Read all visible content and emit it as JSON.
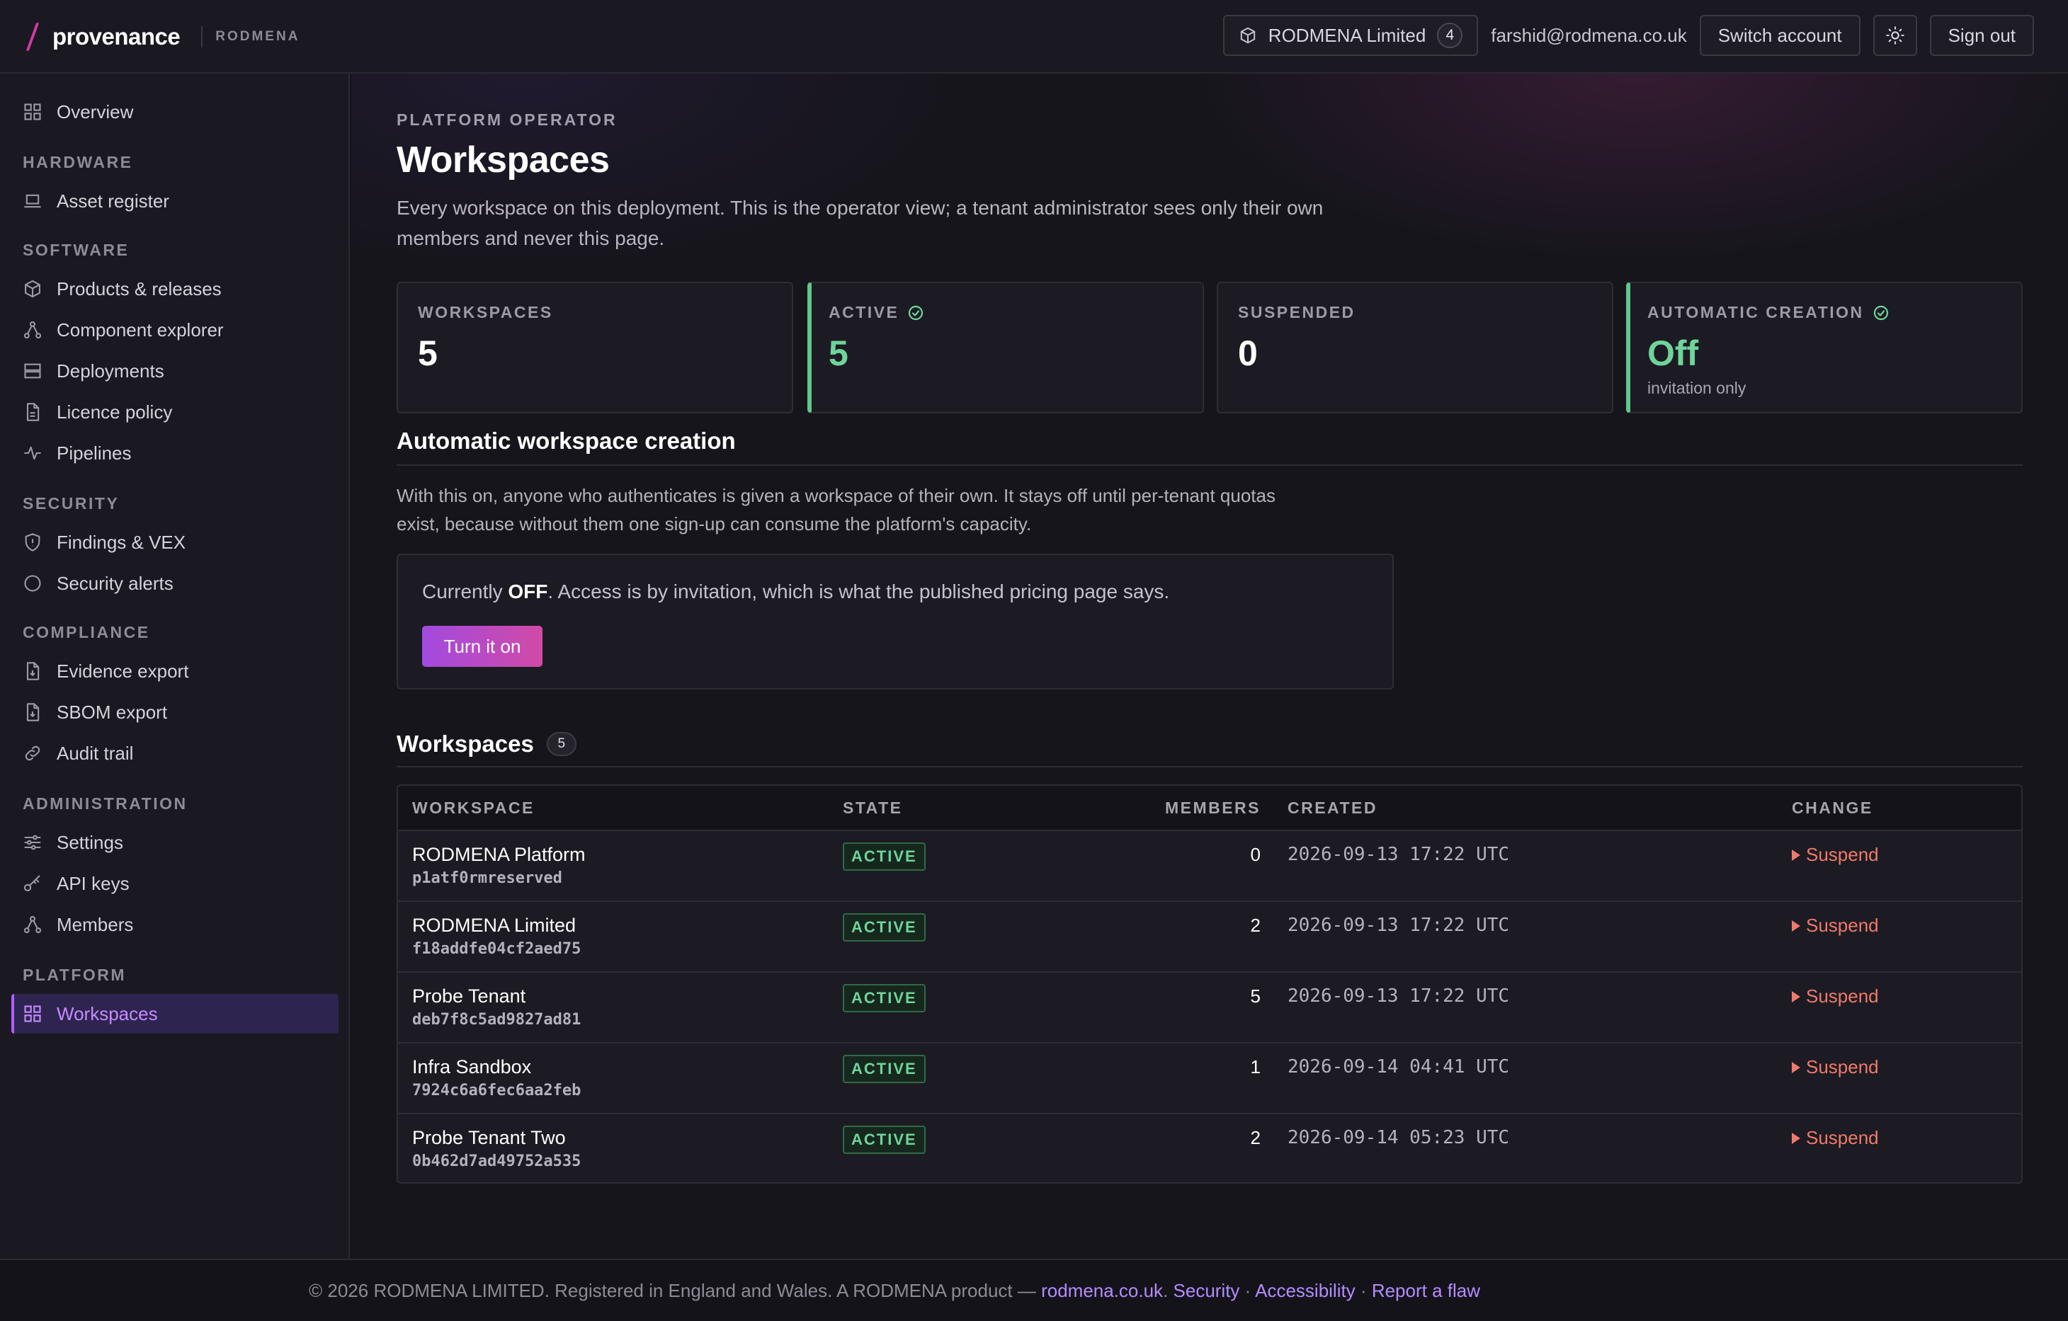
{
  "brand": {
    "name": "provenance",
    "org": "RODMENA"
  },
  "topbar": {
    "tenant_name": "RODMENA Limited",
    "tenant_count": "4",
    "email": "farshid@rodmena.co.uk",
    "switch_label": "Switch account",
    "signout_label": "Sign out"
  },
  "sidebar": {
    "overview": "Overview",
    "hardware_head": "HARDWARE",
    "asset_register": "Asset register",
    "software_head": "SOFTWARE",
    "products": "Products & releases",
    "component_explorer": "Component explorer",
    "deployments": "Deployments",
    "licence_policy": "Licence policy",
    "pipelines": "Pipelines",
    "security_head": "SECURITY",
    "findings": "Findings & VEX",
    "security_alerts": "Security alerts",
    "compliance_head": "COMPLIANCE",
    "evidence_export": "Evidence export",
    "sbom_export": "SBOM export",
    "audit_trail": "Audit trail",
    "admin_head": "ADMINISTRATION",
    "settings": "Settings",
    "api_keys": "API keys",
    "members": "Members",
    "platform_head": "PLATFORM",
    "workspaces": "Workspaces"
  },
  "page": {
    "eyebrow": "PLATFORM OPERATOR",
    "title": "Workspaces",
    "description": "Every workspace on this deployment. This is the operator view; a tenant administrator sees only their own members and never this page."
  },
  "stats": {
    "workspaces_label": "WORKSPACES",
    "workspaces_value": "5",
    "active_label": "ACTIVE",
    "active_value": "5",
    "suspended_label": "SUSPENDED",
    "suspended_value": "0",
    "auto_label": "AUTOMATIC CREATION",
    "auto_value": "Off",
    "auto_sub": "invitation only"
  },
  "auto_section": {
    "title": "Automatic workspace creation",
    "description": "With this on, anyone who authenticates is given a workspace of their own. It stays off until per-tenant quotas exist, because without them one sign-up can consume the platform's capacity.",
    "status_prefix": "Currently ",
    "status_value": "OFF",
    "status_suffix": ". Access is by invitation, which is what the published pricing page says.",
    "button_label": "Turn it on"
  },
  "table_section": {
    "title": "Workspaces",
    "count": "5",
    "headers": {
      "workspace": "WORKSPACE",
      "state": "STATE",
      "members": "MEMBERS",
      "created": "CREATED",
      "change": "CHANGE"
    },
    "rows": [
      {
        "name": "RODMENA Platform",
        "id": "p1atf0rmreserved",
        "state": "ACTIVE",
        "members": "0",
        "created": "2026-09-13 17:22 UTC",
        "action": "Suspend"
      },
      {
        "name": "RODMENA Limited",
        "id": "f18addfe04cf2aed75",
        "state": "ACTIVE",
        "members": "2",
        "created": "2026-09-13 17:22 UTC",
        "action": "Suspend"
      },
      {
        "name": "Probe Tenant",
        "id": "deb7f8c5ad9827ad81",
        "state": "ACTIVE",
        "members": "5",
        "created": "2026-09-13 17:22 UTC",
        "action": "Suspend"
      },
      {
        "name": "Infra Sandbox",
        "id": "7924c6a6fec6aa2feb",
        "state": "ACTIVE",
        "members": "1",
        "created": "2026-09-14 04:41 UTC",
        "action": "Suspend"
      },
      {
        "name": "Probe Tenant Two",
        "id": "0b462d7ad49752a535",
        "state": "ACTIVE",
        "members": "2",
        "created": "2026-09-14 05:23 UTC",
        "action": "Suspend"
      }
    ]
  },
  "footer": {
    "text": "© 2026 RODMENA LIMITED. Registered in England and Wales. A RODMENA product — ",
    "link_site": "rodmena.co.uk",
    "link_security": "Security",
    "link_accessibility": "Accessibility",
    "link_flaw": "Report a flaw"
  },
  "colors": {
    "accent": "#b25cff",
    "active_green": "#6fd49a",
    "danger": "#f07a6a",
    "brand_pink": "#d23aa8"
  }
}
